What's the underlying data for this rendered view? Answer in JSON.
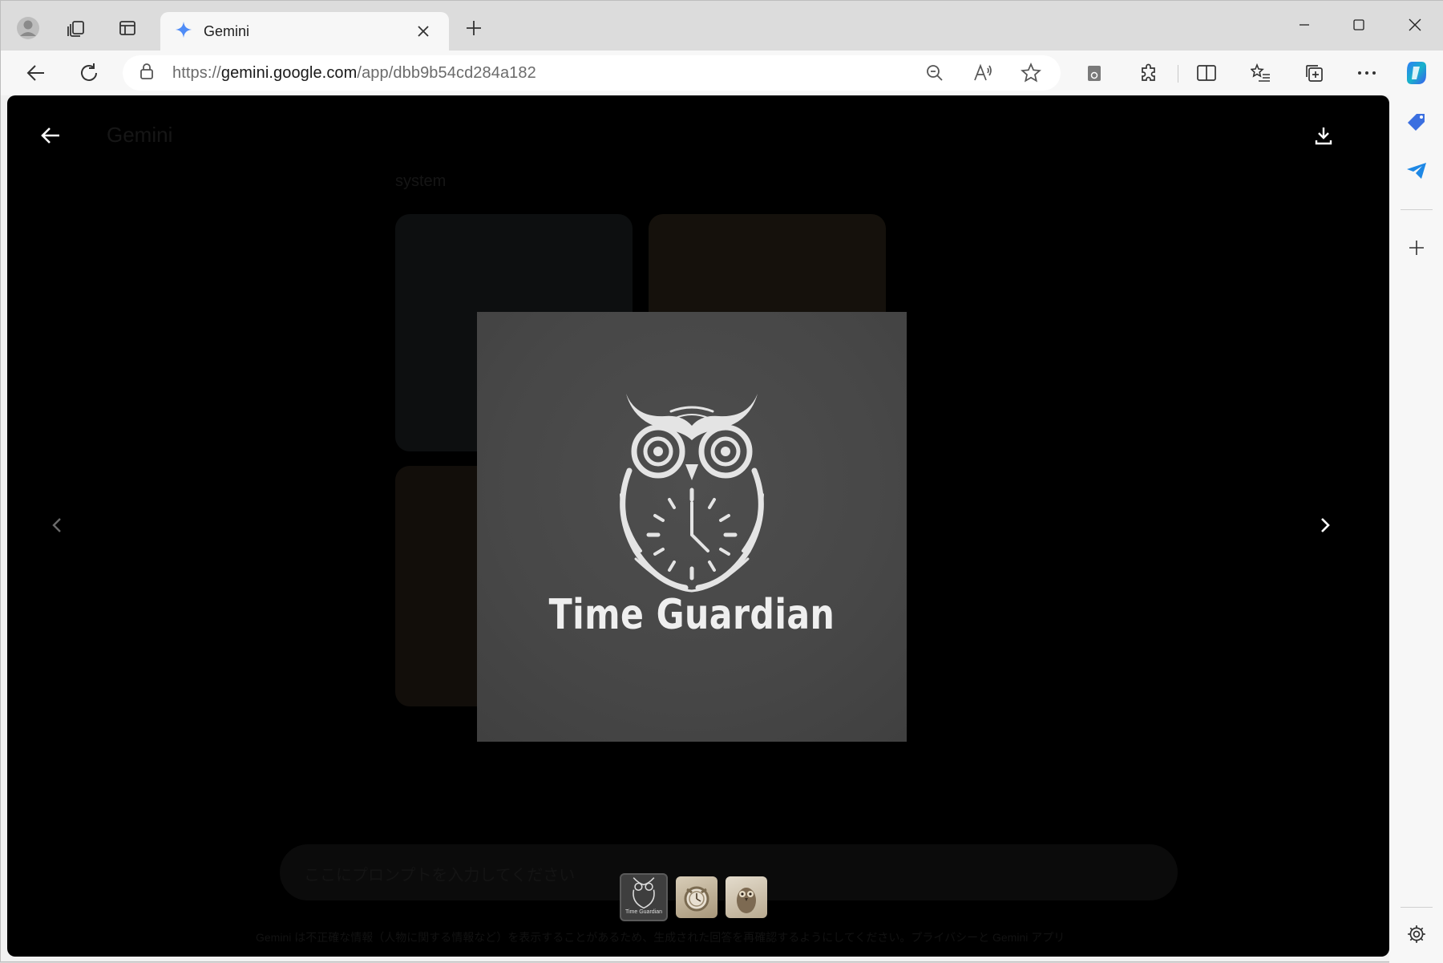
{
  "browser": {
    "tab": {
      "title": "Gemini"
    },
    "address": {
      "url_prefix": "https://",
      "url_domain": "gemini.google.com",
      "url_path": "/app/dbb9b54cd284a182"
    }
  },
  "viewer": {
    "image_text": "Time Guardian",
    "thumbnails": [
      {
        "name": "owl-logo",
        "caption": "Time Guardian",
        "active": true
      },
      {
        "name": "owl-clock",
        "caption": "",
        "active": false
      },
      {
        "name": "owl-photo",
        "caption": "",
        "active": false
      }
    ]
  },
  "background": {
    "app_title": "Gemini",
    "response_label": "system",
    "input_placeholder": "ここにプロンプトを入力してください",
    "footer_note": "Gemini は不正確な情報（人物に関する情報など）を表示することがあるため、生成された回答を再確認するようにしてください。プライバシーと Gemini アプリ"
  },
  "colors": {
    "accent": "#4f8cf7",
    "overlay": "#000000",
    "image_bg": "#474747"
  }
}
